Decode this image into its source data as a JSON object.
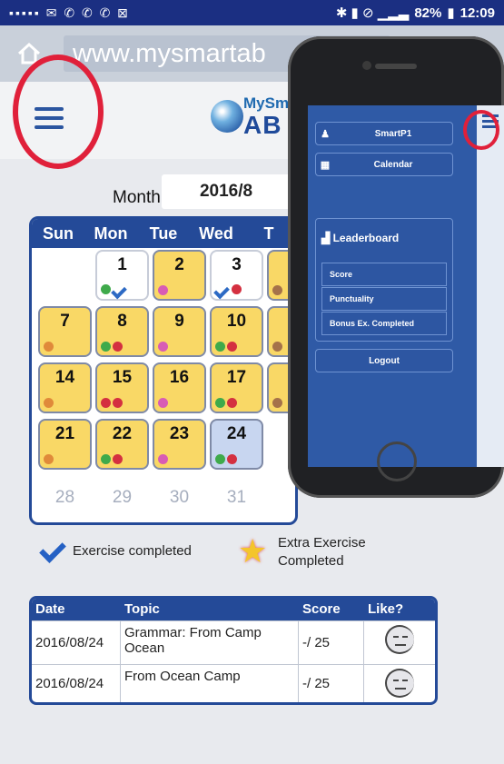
{
  "status_bar": {
    "battery": "82%",
    "time": "12:09"
  },
  "browser": {
    "url": "www.mysmartab"
  },
  "app": {
    "brand_top": "MySm",
    "brand_bottom": "AB"
  },
  "month": {
    "label": "Month",
    "value": "2016/8"
  },
  "calendar": {
    "weekdays": [
      "Sun",
      "Mon",
      "Tue",
      "Wed",
      "T"
    ],
    "days": [
      {
        "num": "1"
      },
      {
        "num": "2"
      },
      {
        "num": "3"
      },
      {
        "num": ""
      },
      {
        "num": "7"
      },
      {
        "num": "8"
      },
      {
        "num": "9"
      },
      {
        "num": "10"
      },
      {
        "num": "1"
      },
      {
        "num": "14"
      },
      {
        "num": "15"
      },
      {
        "num": "16"
      },
      {
        "num": "17"
      },
      {
        "num": "1"
      },
      {
        "num": "21"
      },
      {
        "num": "22"
      },
      {
        "num": "23"
      },
      {
        "num": "24"
      },
      {
        "num": "28"
      },
      {
        "num": "29"
      },
      {
        "num": "30"
      },
      {
        "num": "31"
      }
    ]
  },
  "legend": {
    "completed": "Exercise completed",
    "extra_line1": "Extra Exercise",
    "extra_line2": "Completed"
  },
  "table": {
    "headers": [
      "Date",
      "Topic",
      "Score",
      "Like?"
    ],
    "rows": [
      {
        "date": "2016/08/24",
        "topic": "Grammar: From Camp Ocean",
        "score": "-/ 25"
      },
      {
        "date": "2016/08/24",
        "topic": "From Ocean Camp",
        "score": "-/ 25"
      }
    ]
  },
  "phone_menu": {
    "items": [
      {
        "label": "SmartP1",
        "icon": "user-icon"
      },
      {
        "label": "Calendar",
        "icon": "calendar-icon"
      }
    ],
    "leaderboard": {
      "title": "Leaderboard",
      "sub_items": [
        "Score",
        "Punctuality",
        "Bonus Ex. Completed"
      ]
    },
    "logout": "Logout"
  }
}
